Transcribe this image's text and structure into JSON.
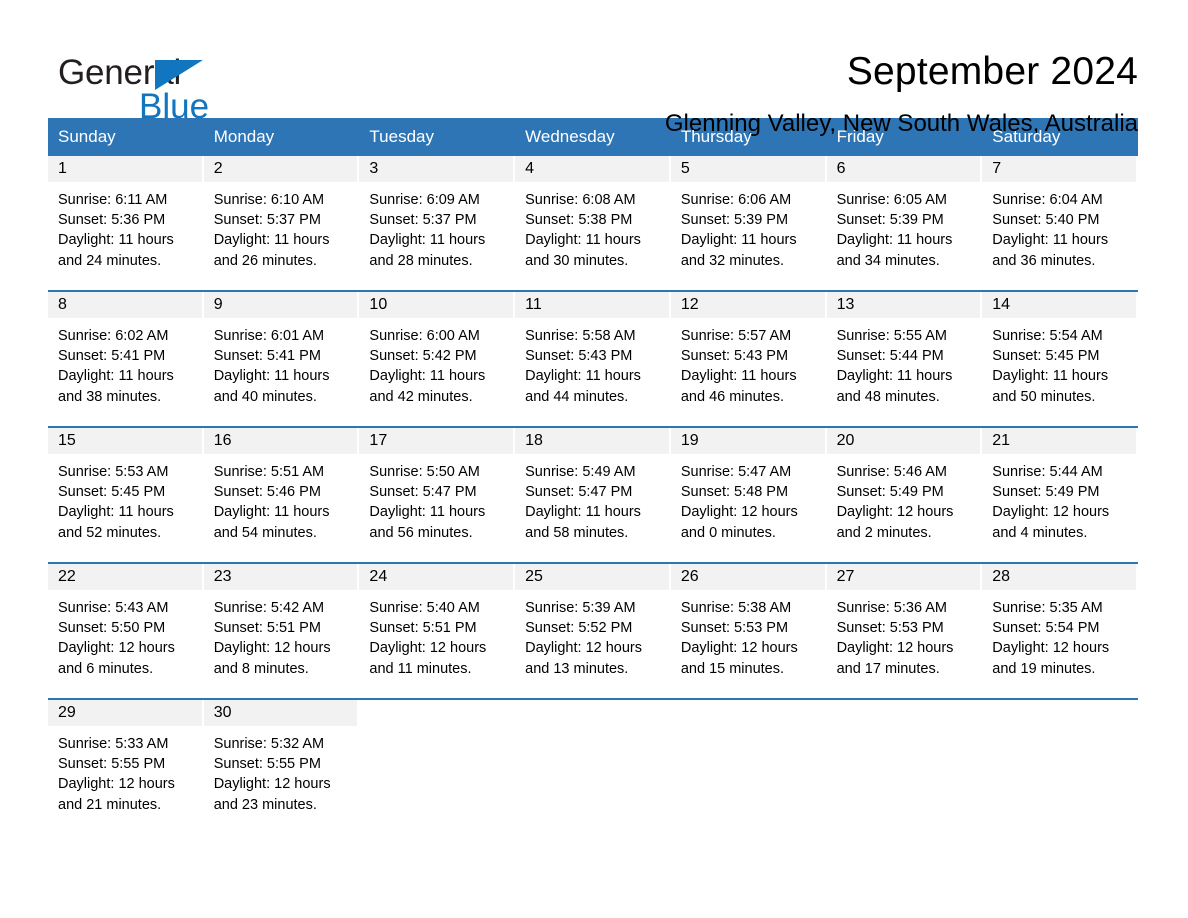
{
  "brand": {
    "name_part1": "General",
    "name_part2": "Blue",
    "triangle_color": "#1275c0"
  },
  "header": {
    "month_title": "September 2024",
    "location": "Glenning Valley, New South Wales, Australia"
  },
  "theme": {
    "header_blue": "#2e75b6",
    "daynum_band": "#f2f2f2",
    "text": "#000000"
  },
  "weekdays": [
    "Sunday",
    "Monday",
    "Tuesday",
    "Wednesday",
    "Thursday",
    "Friday",
    "Saturday"
  ],
  "weeks": [
    [
      {
        "day": "1",
        "sunrise": "Sunrise: 6:11 AM",
        "sunset": "Sunset: 5:36 PM",
        "daylight": "Daylight: 11 hours and 24 minutes."
      },
      {
        "day": "2",
        "sunrise": "Sunrise: 6:10 AM",
        "sunset": "Sunset: 5:37 PM",
        "daylight": "Daylight: 11 hours and 26 minutes."
      },
      {
        "day": "3",
        "sunrise": "Sunrise: 6:09 AM",
        "sunset": "Sunset: 5:37 PM",
        "daylight": "Daylight: 11 hours and 28 minutes."
      },
      {
        "day": "4",
        "sunrise": "Sunrise: 6:08 AM",
        "sunset": "Sunset: 5:38 PM",
        "daylight": "Daylight: 11 hours and 30 minutes."
      },
      {
        "day": "5",
        "sunrise": "Sunrise: 6:06 AM",
        "sunset": "Sunset: 5:39 PM",
        "daylight": "Daylight: 11 hours and 32 minutes."
      },
      {
        "day": "6",
        "sunrise": "Sunrise: 6:05 AM",
        "sunset": "Sunset: 5:39 PM",
        "daylight": "Daylight: 11 hours and 34 minutes."
      },
      {
        "day": "7",
        "sunrise": "Sunrise: 6:04 AM",
        "sunset": "Sunset: 5:40 PM",
        "daylight": "Daylight: 11 hours and 36 minutes."
      }
    ],
    [
      {
        "day": "8",
        "sunrise": "Sunrise: 6:02 AM",
        "sunset": "Sunset: 5:41 PM",
        "daylight": "Daylight: 11 hours and 38 minutes."
      },
      {
        "day": "9",
        "sunrise": "Sunrise: 6:01 AM",
        "sunset": "Sunset: 5:41 PM",
        "daylight": "Daylight: 11 hours and 40 minutes."
      },
      {
        "day": "10",
        "sunrise": "Sunrise: 6:00 AM",
        "sunset": "Sunset: 5:42 PM",
        "daylight": "Daylight: 11 hours and 42 minutes."
      },
      {
        "day": "11",
        "sunrise": "Sunrise: 5:58 AM",
        "sunset": "Sunset: 5:43 PM",
        "daylight": "Daylight: 11 hours and 44 minutes."
      },
      {
        "day": "12",
        "sunrise": "Sunrise: 5:57 AM",
        "sunset": "Sunset: 5:43 PM",
        "daylight": "Daylight: 11 hours and 46 minutes."
      },
      {
        "day": "13",
        "sunrise": "Sunrise: 5:55 AM",
        "sunset": "Sunset: 5:44 PM",
        "daylight": "Daylight: 11 hours and 48 minutes."
      },
      {
        "day": "14",
        "sunrise": "Sunrise: 5:54 AM",
        "sunset": "Sunset: 5:45 PM",
        "daylight": "Daylight: 11 hours and 50 minutes."
      }
    ],
    [
      {
        "day": "15",
        "sunrise": "Sunrise: 5:53 AM",
        "sunset": "Sunset: 5:45 PM",
        "daylight": "Daylight: 11 hours and 52 minutes."
      },
      {
        "day": "16",
        "sunrise": "Sunrise: 5:51 AM",
        "sunset": "Sunset: 5:46 PM",
        "daylight": "Daylight: 11 hours and 54 minutes."
      },
      {
        "day": "17",
        "sunrise": "Sunrise: 5:50 AM",
        "sunset": "Sunset: 5:47 PM",
        "daylight": "Daylight: 11 hours and 56 minutes."
      },
      {
        "day": "18",
        "sunrise": "Sunrise: 5:49 AM",
        "sunset": "Sunset: 5:47 PM",
        "daylight": "Daylight: 11 hours and 58 minutes."
      },
      {
        "day": "19",
        "sunrise": "Sunrise: 5:47 AM",
        "sunset": "Sunset: 5:48 PM",
        "daylight": "Daylight: 12 hours and 0 minutes."
      },
      {
        "day": "20",
        "sunrise": "Sunrise: 5:46 AM",
        "sunset": "Sunset: 5:49 PM",
        "daylight": "Daylight: 12 hours and 2 minutes."
      },
      {
        "day": "21",
        "sunrise": "Sunrise: 5:44 AM",
        "sunset": "Sunset: 5:49 PM",
        "daylight": "Daylight: 12 hours and 4 minutes."
      }
    ],
    [
      {
        "day": "22",
        "sunrise": "Sunrise: 5:43 AM",
        "sunset": "Sunset: 5:50 PM",
        "daylight": "Daylight: 12 hours and 6 minutes."
      },
      {
        "day": "23",
        "sunrise": "Sunrise: 5:42 AM",
        "sunset": "Sunset: 5:51 PM",
        "daylight": "Daylight: 12 hours and 8 minutes."
      },
      {
        "day": "24",
        "sunrise": "Sunrise: 5:40 AM",
        "sunset": "Sunset: 5:51 PM",
        "daylight": "Daylight: 12 hours and 11 minutes."
      },
      {
        "day": "25",
        "sunrise": "Sunrise: 5:39 AM",
        "sunset": "Sunset: 5:52 PM",
        "daylight": "Daylight: 12 hours and 13 minutes."
      },
      {
        "day": "26",
        "sunrise": "Sunrise: 5:38 AM",
        "sunset": "Sunset: 5:53 PM",
        "daylight": "Daylight: 12 hours and 15 minutes."
      },
      {
        "day": "27",
        "sunrise": "Sunrise: 5:36 AM",
        "sunset": "Sunset: 5:53 PM",
        "daylight": "Daylight: 12 hours and 17 minutes."
      },
      {
        "day": "28",
        "sunrise": "Sunrise: 5:35 AM",
        "sunset": "Sunset: 5:54 PM",
        "daylight": "Daylight: 12 hours and 19 minutes."
      }
    ],
    [
      {
        "day": "29",
        "sunrise": "Sunrise: 5:33 AM",
        "sunset": "Sunset: 5:55 PM",
        "daylight": "Daylight: 12 hours and 21 minutes."
      },
      {
        "day": "30",
        "sunrise": "Sunrise: 5:32 AM",
        "sunset": "Sunset: 5:55 PM",
        "daylight": "Daylight: 12 hours and 23 minutes."
      },
      {
        "day": "",
        "sunrise": "",
        "sunset": "",
        "daylight": ""
      },
      {
        "day": "",
        "sunrise": "",
        "sunset": "",
        "daylight": ""
      },
      {
        "day": "",
        "sunrise": "",
        "sunset": "",
        "daylight": ""
      },
      {
        "day": "",
        "sunrise": "",
        "sunset": "",
        "daylight": ""
      },
      {
        "day": "",
        "sunrise": "",
        "sunset": "",
        "daylight": ""
      }
    ]
  ]
}
